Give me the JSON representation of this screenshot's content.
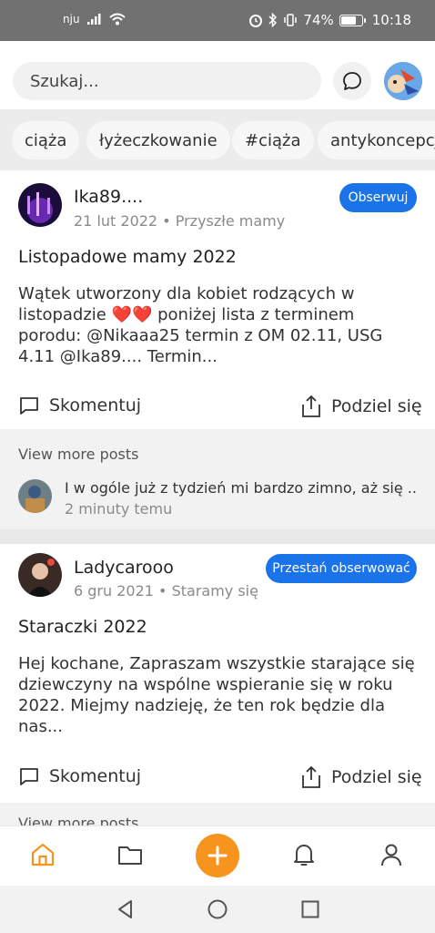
{
  "status_bar": {
    "carrier": "nju",
    "battery_percent": "74%",
    "battery_level": 0.74,
    "time": "10:18"
  },
  "search": {
    "placeholder": "Szukaj..."
  },
  "tags": [
    "ciąża",
    "łyżeczkowanie",
    "#ciąża",
    "antykoncepcja"
  ],
  "posts": [
    {
      "author": "Ika89....",
      "date": "21 lut 2022",
      "group": "Przyszłe mamy",
      "follow_label": "Obserwuj",
      "title": "Listopadowe mamy 2022",
      "body": "Wątek utworzony dla kobiet rodzących w listopadzie ❤️❤️ poniżej lista z terminem porodu: @Nikaaa25 termin z OM 02.11, USG 4.11 @Ika89.... Termin...",
      "comment_label": "Skomentuj",
      "share_label": "Podziel się",
      "more_label": "View more posts",
      "reply_text": "I w ogóle już z tydzień mi bardzo zimno, aż się ...",
      "reply_time": "2 minuty temu"
    },
    {
      "author": "Ladycarooo",
      "date": "6 gru 2021",
      "group": "Staramy się",
      "follow_label": "Przestań obserwować",
      "title": "Staraczki 2022",
      "body": "Hej kochane, Zapraszam wszystkie starające się dziewczyny na wspólne wspieranie się w roku 2022. Miejmy nadzieję, że ten rok będzie dla nas...",
      "comment_label": "Skomentuj",
      "share_label": "Podziel się",
      "more_label": "View more posts"
    }
  ],
  "bottom_nav": [
    "home-icon",
    "folder-icon",
    "add-icon",
    "bell-icon",
    "profile-icon"
  ],
  "colors": {
    "accent": "#f7941d",
    "follow_blue": "#1a73e8"
  }
}
